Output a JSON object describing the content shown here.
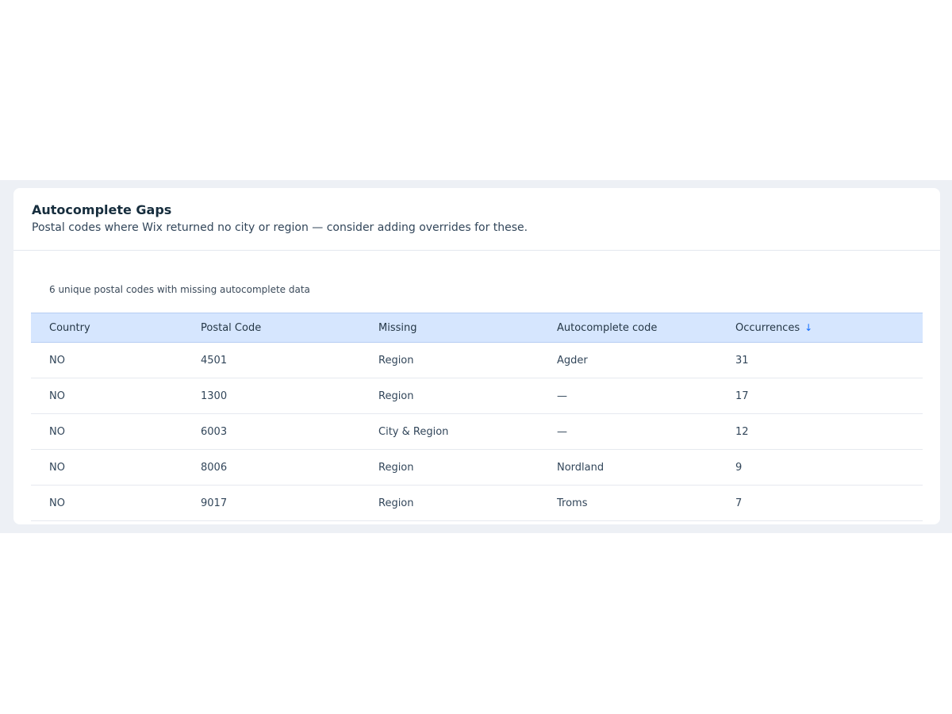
{
  "card": {
    "title": "Autocomplete Gaps",
    "subtitle": "Postal codes where Wix returned no city or region — consider adding overrides for these."
  },
  "summary": "6 unique postal codes with missing autocomplete data",
  "table": {
    "headers": [
      "Country",
      "Postal Code",
      "Missing",
      "Autocomplete code",
      "Occurrences"
    ],
    "sort": {
      "column": "Occurrences",
      "direction": "descending",
      "icon": "arrow-down-icon"
    },
    "rows": [
      [
        "NO",
        "4501",
        "Region",
        "Agder",
        "31"
      ],
      [
        "NO",
        "1300",
        "Region",
        "—",
        "17"
      ],
      [
        "NO",
        "6003",
        "City & Region",
        "—",
        "12"
      ],
      [
        "NO",
        "8006",
        "Region",
        "Nordland",
        "9"
      ],
      [
        "NO",
        "9017",
        "Region",
        "Troms",
        "7"
      ]
    ]
  },
  "colors": {
    "page_band": "#edf0f5",
    "header_bg": "#d6e6fe",
    "sort_accent": "#116dff"
  }
}
